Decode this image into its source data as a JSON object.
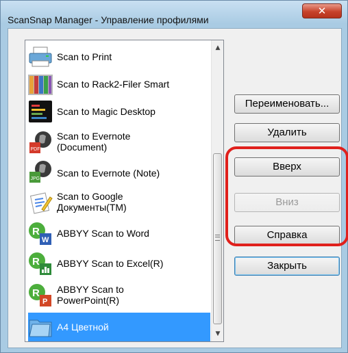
{
  "window": {
    "title": "ScanSnap Manager - Управление профилями",
    "close_glyph": "✕"
  },
  "profiles": [
    {
      "label": "Scan to Print",
      "icon": "printer-icon"
    },
    {
      "label": "Scan to Rack2-Filer Smart",
      "icon": "binders-icon"
    },
    {
      "label": "Scan to Magic Desktop",
      "icon": "magic-desktop-icon"
    },
    {
      "label": "Scan to Evernote\n(Document)",
      "icon": "evernote-pdf-icon"
    },
    {
      "label": "Scan to Evernote (Note)",
      "icon": "evernote-jpg-icon"
    },
    {
      "label": "Scan to Google\nДокументы(TM)",
      "icon": "google-docs-icon"
    },
    {
      "label": "ABBYY Scan to Word",
      "icon": "abbyy-word-icon"
    },
    {
      "label": "ABBYY Scan to Excel(R)",
      "icon": "abbyy-excel-icon"
    },
    {
      "label": "ABBYY Scan to\nPowerPoint(R)",
      "icon": "abbyy-powerpoint-icon"
    },
    {
      "label": "A4 Цветной",
      "icon": "folder-icon",
      "selected": true
    }
  ],
  "buttons": {
    "rename": "Переименовать...",
    "delete": "Удалить",
    "up": "Вверх",
    "down": "Вниз",
    "help": "Справка",
    "close": "Закрыть"
  },
  "scrollbar": {
    "up_glyph": "▲",
    "down_glyph": "▼"
  },
  "colors": {
    "selection": "#3399ff",
    "highlight_ring": "#e0201c",
    "title_bar": "#a9cbe3"
  }
}
